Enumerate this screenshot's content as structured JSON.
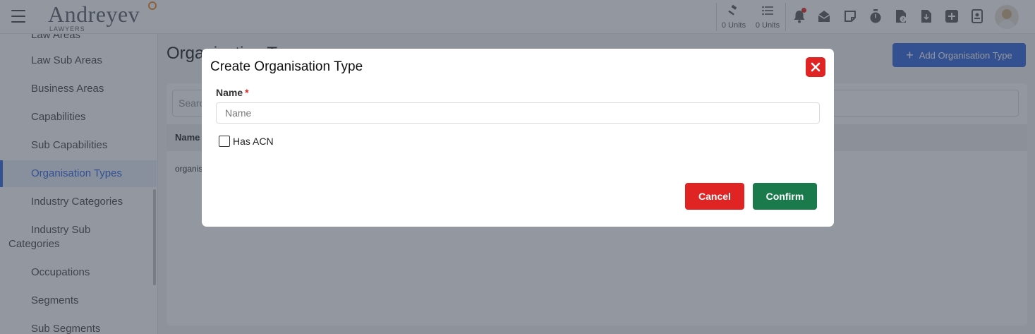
{
  "header": {
    "logo_text": "Andreyev",
    "logo_sub": "LAWYERS",
    "units": [
      {
        "label": "0 Units",
        "icon": "gavel-icon"
      },
      {
        "label": "0 Units",
        "icon": "list-icon"
      }
    ],
    "icons": [
      "bell-icon",
      "mail-icon",
      "note-icon",
      "stopwatch-icon",
      "document-question-icon",
      "download-file-icon",
      "plus-square-icon",
      "id-badge-icon"
    ]
  },
  "sidebar": {
    "items": [
      {
        "label": "Law Areas"
      },
      {
        "label": "Law Sub Areas"
      },
      {
        "label": "Business Areas"
      },
      {
        "label": "Capabilities"
      },
      {
        "label": "Sub Capabilities"
      },
      {
        "label": "Organisation Types",
        "active": true
      },
      {
        "label": "Industry Categories"
      },
      {
        "label": "Industry Sub Categories"
      },
      {
        "label": "Occupations"
      },
      {
        "label": "Segments"
      },
      {
        "label": "Sub Segments"
      }
    ]
  },
  "main": {
    "page_title": "Organisation Types",
    "add_button": "Add Organisation Type",
    "search_placeholder": "Search",
    "table_header": "Name",
    "rows": [
      "organisation"
    ]
  },
  "modal": {
    "title": "Create Organisation Type",
    "name_label": "Name",
    "required_mark": "*",
    "name_placeholder": "Name",
    "name_value": "",
    "checkbox_label": "Has ACN",
    "checkbox_checked": false,
    "cancel_label": "Cancel",
    "confirm_label": "Confirm"
  },
  "colors": {
    "primary": "#3f73e2",
    "danger": "#e02424",
    "success": "#1a7a4c",
    "overlay": "rgba(40,48,64,0.5)"
  }
}
